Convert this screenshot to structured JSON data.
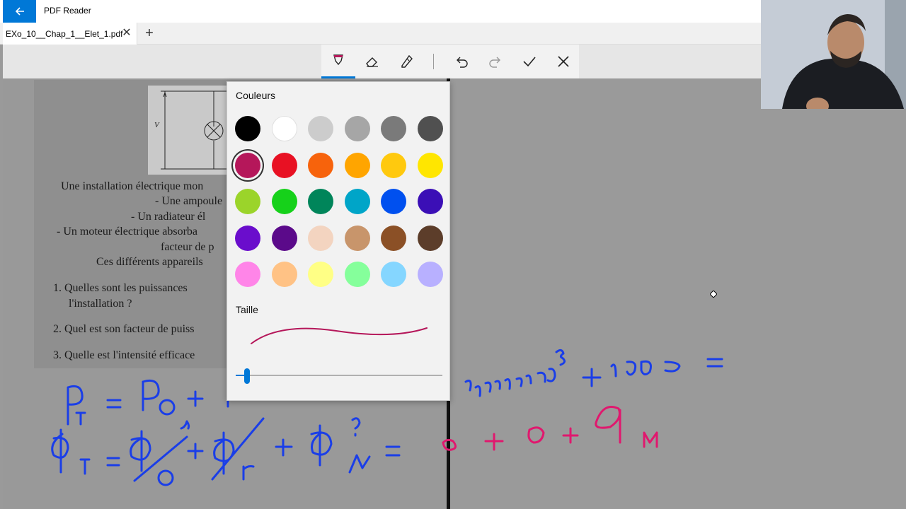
{
  "titlebar": {
    "app_title": "PDF Reader",
    "back_icon": "back-arrow-icon"
  },
  "tabs": {
    "items": [
      {
        "label": "EXo_10__Chap_1__Elet_1.pdf"
      }
    ],
    "close_glyph": "✕",
    "add_glyph": "+"
  },
  "ink_toolbar": {
    "tools": [
      "ballpoint-pen-icon",
      "eraser-icon",
      "highlighter-icon",
      "undo-icon",
      "redo-icon",
      "done-check-icon",
      "close-icon"
    ],
    "active_tool": "ballpoint-pen-icon"
  },
  "document": {
    "circuit_label": "V",
    "lines": [
      "Une installation électrique mon",
      "- Une ampoule",
      "- Un radiateur él",
      "- Un moteur électrique absorba",
      "facteur de p",
      "Ces différents appareils",
      "1. Quelles sont les puissances",
      "l'installation ?",
      "2. Quel est son facteur de puiss",
      "3. Quelle est l'intensité efficace"
    ]
  },
  "color_popup": {
    "colors_heading": "Couleurs",
    "size_heading": "Taille",
    "selected_color": "#b5175a",
    "colors": [
      [
        "#000000",
        "#ffffff",
        "#cccccc",
        "#a6a6a6",
        "#7a7a7a",
        "#505050"
      ],
      [
        "#b5175a",
        "#e81123",
        "#f7630c",
        "#ffa500",
        "#ffc90e",
        "#ffe600"
      ],
      [
        "#9bd42a",
        "#16d11a",
        "#00855a",
        "#00a5c8",
        "#0050ef",
        "#3b0fb6"
      ],
      [
        "#6a0dcc",
        "#5b0a8a",
        "#f3d4c0",
        "#c8956b",
        "#8b5026",
        "#5c3d2a"
      ],
      [
        "#ff85e8",
        "#ffc285",
        "#ffff85",
        "#85ff9b",
        "#85d6ff",
        "#b8b0ff"
      ]
    ],
    "stroke_size": 0.05
  },
  "annotations": {
    "ink_blue": "#1a3ee8",
    "ink_magenta": "#e0186e"
  }
}
